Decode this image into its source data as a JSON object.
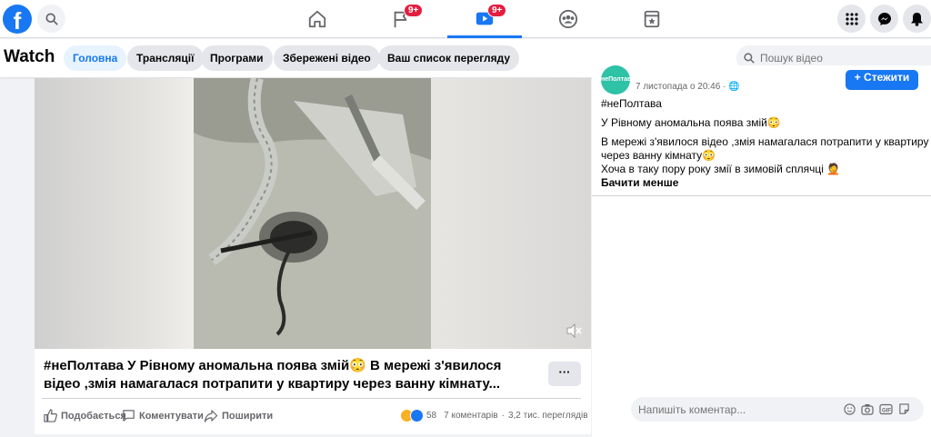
{
  "colors": {
    "brand": "#1877f2",
    "badge": "#e41e3f",
    "text_secondary": "#65676b"
  },
  "topnav": {
    "logo": "f",
    "tabs": [
      {
        "icon": "home-icon"
      },
      {
        "icon": "flag-icon",
        "badge": "9+"
      },
      {
        "icon": "watch-icon",
        "badge": "9+",
        "active": true
      },
      {
        "icon": "groups-icon"
      },
      {
        "icon": "gaming-icon"
      }
    ],
    "right_icons": [
      "menu-grid-icon",
      "messenger-icon",
      "notifications-icon"
    ]
  },
  "watch": {
    "title": "Watch",
    "tabs": [
      "Головна",
      "Трансляції",
      "Програми",
      "Збережені відео",
      "Ваш список перегляду"
    ],
    "active_tab": "Головна",
    "search_placeholder": "Пошук відео"
  },
  "post": {
    "title": "#неПолтава У Рівному аномальна поява змій😳 В мережі з'явилося відео ,змія намагалася потрапити у квартиру через ванну кімнату...",
    "more_label": "···",
    "actions": {
      "like": "Подобається",
      "comment": "Коментувати",
      "share": "Поширити"
    },
    "reactions_count": "58",
    "comments": "7 коментарів",
    "views": "3,2 тис. переглядів"
  },
  "panel": {
    "avatar_text": "неПолтава",
    "time": "7 листопада о 20:46 · 🌐",
    "follow_label": "+ Стежити",
    "hashtag": "#неПолтава",
    "line1": "У Рівному аномальна поява змій😳",
    "line2": "В мережі з'явилося відео ,змія намагалася потрапити у квартиру",
    "line3": "через ванну кімнату😳",
    "line4": "Хоча в таку пору року змії в зимовій сплячці 🤦",
    "see_less": "Бачити менше",
    "comment_placeholder": "Напишіть коментар..."
  }
}
